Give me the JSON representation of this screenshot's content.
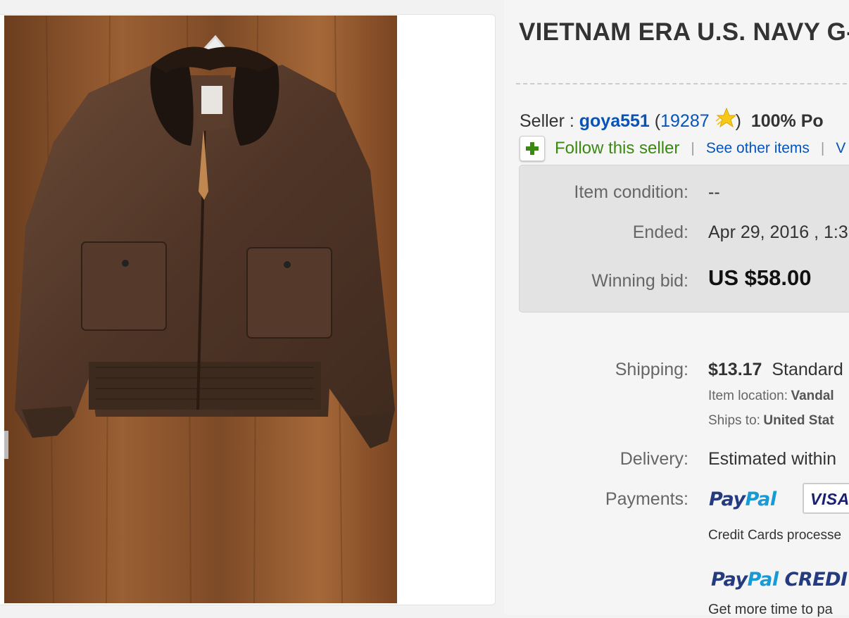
{
  "listing": {
    "title": "VIETNAM ERA U.S. NAVY G-1"
  },
  "seller": {
    "label": "Seller :",
    "username": "goya551",
    "open_paren": "(",
    "feedback_score": "19287",
    "close_paren": ")",
    "positive": "100% Po",
    "follow_label": "Follow this seller",
    "separator": "|",
    "see_other_items": "See other items",
    "more_link": "V"
  },
  "summary": {
    "condition_label": "Item condition:",
    "condition_value": "--",
    "ended_label": "Ended:",
    "ended_value": "Apr 29, 2016 , 1:3",
    "bid_label": "Winning bid:",
    "bid_value": "US $58.00"
  },
  "shipping": {
    "label": "Shipping:",
    "cost": "$13.17",
    "method": "Standard",
    "location_label": "Item location:",
    "location_value": "Vandal",
    "ships_to_label": "Ships to:",
    "ships_to_value": "United Stat"
  },
  "delivery": {
    "label": "Delivery:",
    "value": "Estimated within"
  },
  "payments": {
    "label": "Payments:",
    "paypal_pay": "Pay",
    "paypal_pal": "Pal",
    "visa": "VISA",
    "credit_note": "Credit Cards processe",
    "paypal_credit_pay": "Pay",
    "paypal_credit_pal": "Pal",
    "paypal_credit_word": "CREDI",
    "credit_tagline": "Get more time to pa"
  },
  "colors": {
    "link_blue": "#0654ba",
    "follow_green": "#3a8a12",
    "paypal_dark": "#253b80",
    "paypal_light": "#179bd7"
  },
  "icons": [
    "follow-plus-icon",
    "feedback-star-icon"
  ]
}
